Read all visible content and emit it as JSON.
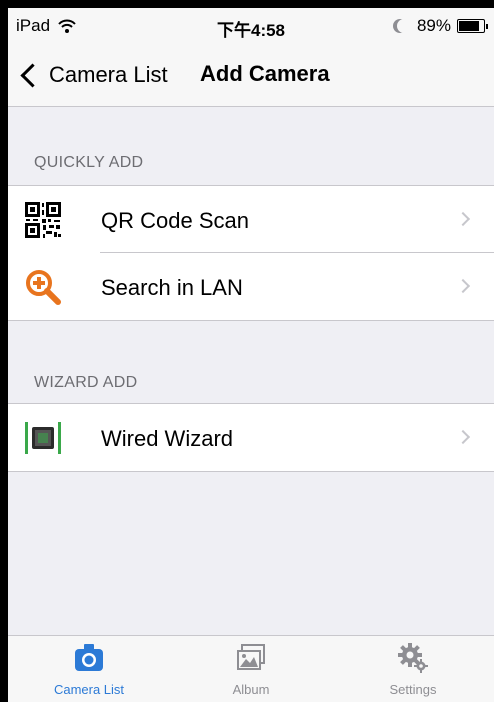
{
  "status_bar": {
    "device": "iPad",
    "time": "下午4:58",
    "battery": "89%",
    "battery_level": 0.89
  },
  "nav": {
    "back_label": "Camera List",
    "title": "Add Camera"
  },
  "sections": [
    {
      "header": "QUICKLY ADD",
      "rows": [
        {
          "label": "QR Code Scan",
          "icon": "qr-code-icon"
        },
        {
          "label": "Search in LAN",
          "icon": "search-plus-icon"
        }
      ]
    },
    {
      "header": "WIZARD ADD",
      "rows": [
        {
          "label": "Wired Wizard",
          "icon": "wired-wizard-icon"
        }
      ]
    }
  ],
  "tabs": [
    {
      "label": "Camera List",
      "icon": "camera-icon",
      "active": true
    },
    {
      "label": "Album",
      "icon": "album-icon",
      "active": false
    },
    {
      "label": "Settings",
      "icon": "gear-icon",
      "active": false
    }
  ],
  "colors": {
    "accent": "#2c7ad6",
    "search_icon": "#e8741e",
    "wizard_green": "#3aa84a",
    "background": "#efeff4"
  }
}
